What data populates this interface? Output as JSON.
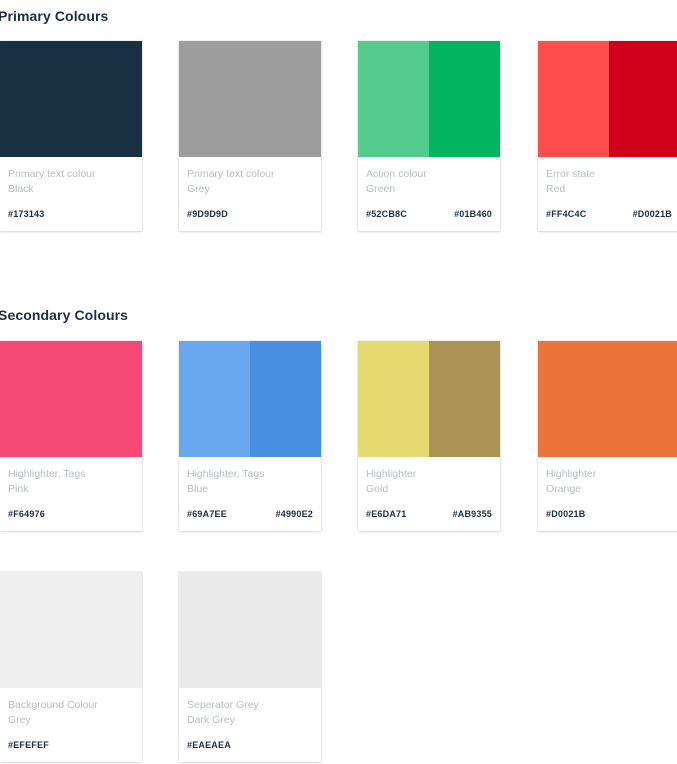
{
  "sections": [
    {
      "title": "Primary Colours",
      "cards": [
        {
          "line1": "Primary text colour",
          "line2": "Black",
          "codes": [
            "#173143"
          ],
          "swatches": [
            "#173143"
          ]
        },
        {
          "line1": "Primary text colour",
          "line2": "Grey",
          "codes": [
            "#9D9D9D"
          ],
          "swatches": [
            "#9D9D9D"
          ]
        },
        {
          "line1": "Action colour",
          "line2": "Green",
          "codes": [
            "#52CB8C",
            "#01B460"
          ],
          "swatches": [
            "#52CB8C",
            "#01B460"
          ]
        },
        {
          "line1": "Error state",
          "line2": "Red",
          "codes": [
            "#FF4C4C",
            "#D0021B"
          ],
          "swatches": [
            "#FF4C4C",
            "#D0021B"
          ]
        }
      ]
    },
    {
      "title": "Secondary Colours",
      "cards": [
        {
          "line1": "Highlighter, Tags",
          "line2": "Pink",
          "codes": [
            "#F64976"
          ],
          "swatches": [
            "#F64976"
          ]
        },
        {
          "line1": "Highlighter, Tags",
          "line2": "Blue",
          "codes": [
            "#69A7EE",
            "#4990E2"
          ],
          "swatches": [
            "#69A7EE",
            "#4990E2"
          ]
        },
        {
          "line1": "Highlighter",
          "line2": "Gold",
          "codes": [
            "#E6DA71",
            "#AB9355"
          ],
          "swatches": [
            "#E6DA71",
            "#AB9355"
          ]
        },
        {
          "line1": "Highlighter",
          "line2": "Orange",
          "codes": [
            "#D0021B"
          ],
          "swatches": [
            "#EC743A"
          ]
        },
        {
          "line1": "Background Colour",
          "line2": "Grey",
          "codes": [
            "#EFEFEF"
          ],
          "swatches": [
            "#EFEFEF"
          ]
        },
        {
          "line1": "Seperator Grey",
          "line2": "Dark Grey",
          "codes": [
            "#EAEAEA"
          ],
          "swatches": [
            "#EAEAEA"
          ]
        }
      ]
    }
  ]
}
